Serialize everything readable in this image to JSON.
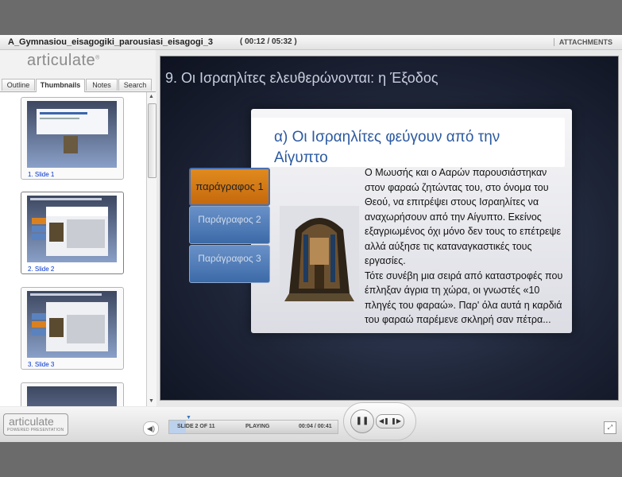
{
  "window": {
    "title": "A_Gymnasiou_eisagogiki_parousiasi_eisagogi_3",
    "time": "( 00:12 / 05:32 )",
    "attachments_label": "ATTACHMENTS"
  },
  "sidebar": {
    "logo": "articulate",
    "tabs": [
      {
        "label": "Outline"
      },
      {
        "label": "Thumbnails"
      },
      {
        "label": "Notes"
      },
      {
        "label": "Search"
      }
    ],
    "thumbnails": [
      {
        "label": "1. Slide 1"
      },
      {
        "label": "2. Slide 2"
      },
      {
        "label": "3. Slide 3"
      }
    ]
  },
  "slide": {
    "title": "9. Οι Ισραηλίτες ελευθερώνονται: η Έξοδος",
    "banner": "α) Οι Ισραηλίτες φεύγουν από την Αίγυπτο",
    "buttons": [
      {
        "label": "παράγραφος 1"
      },
      {
        "label": "Παράγραφος 2"
      },
      {
        "label": "Παράγραφος 3"
      }
    ],
    "body": "Ο Μωυσής και ο Ααρών παρουσιάστηκαν στον φαραώ ζητώντας του, στο όνομα του Θεού, να επιτρέψει στους Ισραηλίτες να αναχωρήσουν από την Αίγυπτο. Εκείνος εξαγριωμένος όχι μόνο δεν τους το επέτρεψε αλλά αύξησε τις καταναγκαστικές τους εργασίες.\nΤότε συνέβη μια σειρά από καταστροφές που έπληξαν άγρια τη χώρα, οι γνωστές «10 πληγές του φαραώ». Παρ' όλα αυτά η καρδιά του φαραώ παρέμενε σκληρή σαν πέτρα..."
  },
  "controls": {
    "logo_top": "articulate",
    "logo_bottom": "POWERED PRESENTATION",
    "slide_counter": "SLIDE 2 OF 11",
    "status": "PLAYING",
    "slide_time": "00:04 / 00:41",
    "progress": 0.1
  }
}
